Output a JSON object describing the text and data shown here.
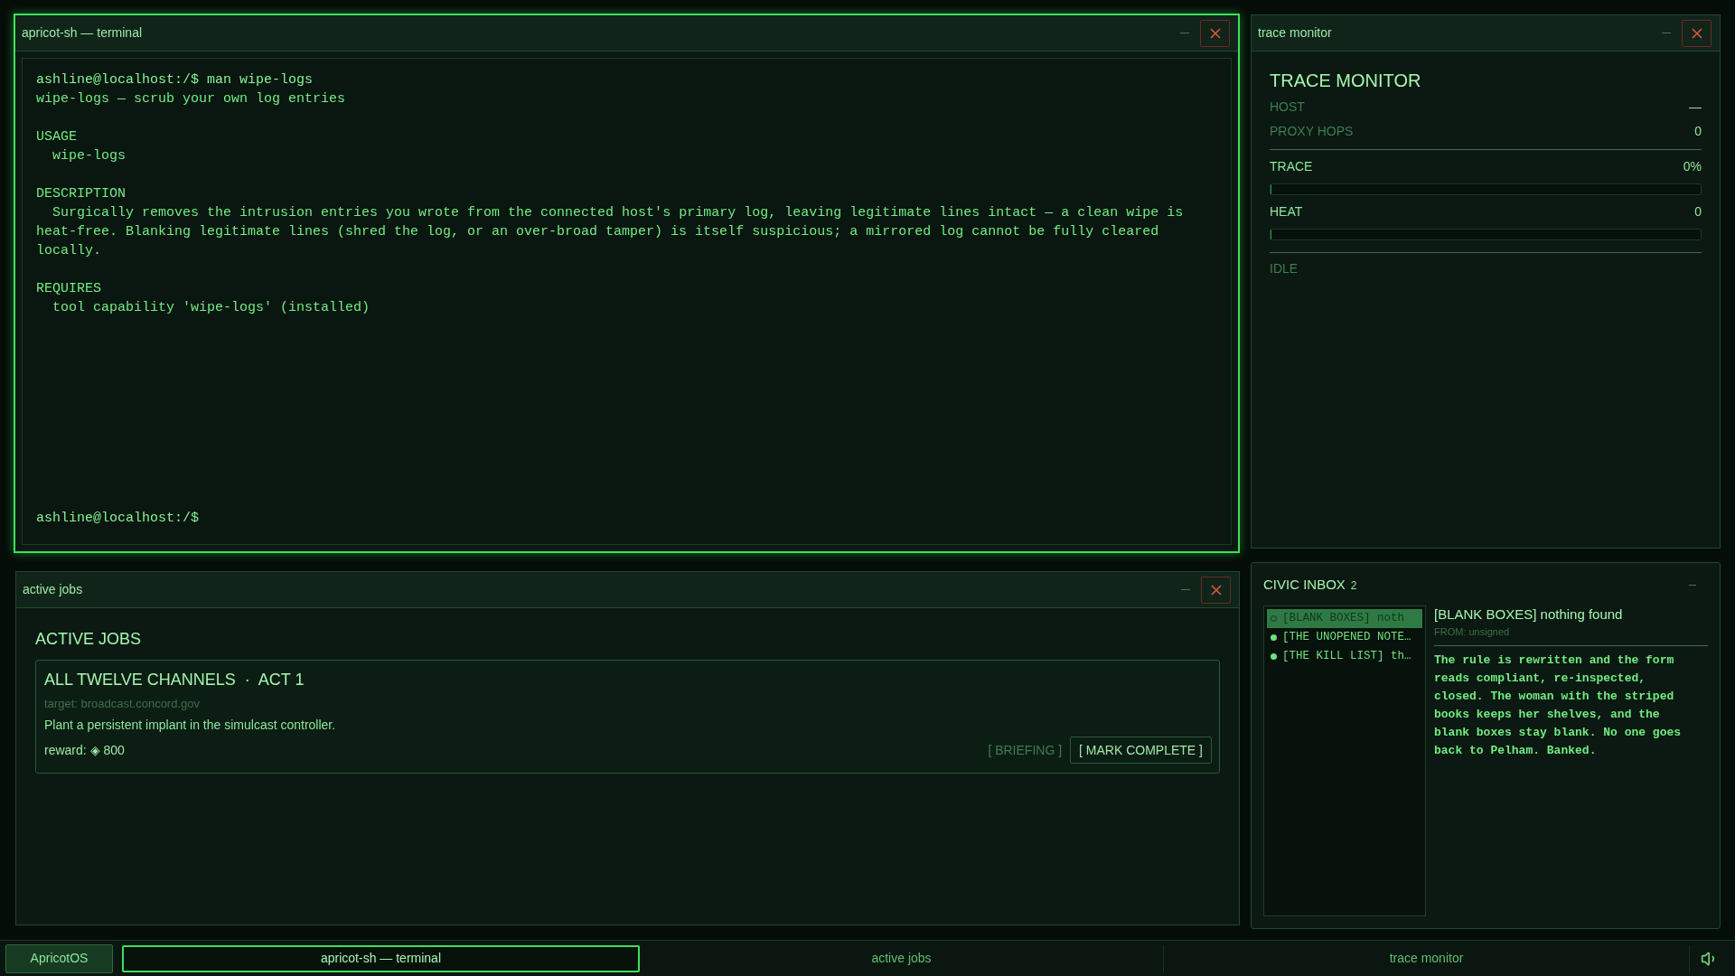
{
  "terminal": {
    "title": "apricot-sh — terminal",
    "focused": true,
    "command": "ashline@localhost:/$ man wipe-logs",
    "summary": "wipe-logs — scrub your own log entries",
    "sections": [
      {
        "heading": "USAGE",
        "body": "  wipe-logs"
      },
      {
        "heading": "DESCRIPTION",
        "body": "  Surgically removes the intrusion entries you wrote from the connected host's primary log, leaving legitimate lines intact — a clean wipe is heat-free. Blanking legitimate lines (shred the log, or an over-broad tamper) is itself suspicious; a mirrored log cannot be fully cleared locally."
      },
      {
        "heading": "REQUIRES",
        "body": "  tool capability 'wipe-logs' (installed)"
      }
    ],
    "prompt": "ashline@localhost:/$"
  },
  "trace_monitor": {
    "title": "trace monitor",
    "focused": false,
    "heading": "TRACE MONITOR",
    "stats": [
      {
        "label": "HOST",
        "value": "—"
      },
      {
        "label": "PROXY HOPS",
        "value": "0"
      }
    ],
    "meters": [
      {
        "label": "TRACE",
        "reading": "0%",
        "level": 0
      },
      {
        "label": "HEAT",
        "reading": "0",
        "level": 0
      }
    ],
    "status": "IDLE"
  },
  "active_jobs": {
    "title": "active jobs",
    "focused": false,
    "heading": "ACTIVE JOBS",
    "jobs": [
      {
        "title": "ALL TWELVE CHANNELS  ·  ACT 1",
        "target": "target: broadcast.concord.gov",
        "description": "Plant a persistent implant in the simulcast controller.",
        "reward": "reward: ◈ 800",
        "actions": [
          {
            "kind": "link",
            "label": "[ BRIEFING ]"
          },
          {
            "kind": "button",
            "label": "[ MARK COMPLETE ]"
          }
        ]
      }
    ]
  },
  "civic_inbox": {
    "title": "CIVIC INBOX",
    "count": "2",
    "messages": [
      {
        "subject": "[BLANK BOXES] noth",
        "selected": true,
        "unread": false
      },
      {
        "subject": "[THE UNOPENED NOTE…",
        "selected": false,
        "unread": true
      },
      {
        "subject": "[THE KILL LIST] th…",
        "selected": false,
        "unread": true
      }
    ],
    "open_message": {
      "subject": "[BLANK BOXES] nothing found",
      "from": "FROM: unsigned",
      "body": "The rule is rewritten and the form reads compliant, re-inspected, closed. The woman with the striped books keeps her shelves, and the blank boxes stay blank. No one goes back to Pelham. Banked."
    }
  },
  "taskbar": {
    "start": "ApricotOS",
    "tasks": [
      {
        "label": "apricot-sh — terminal",
        "selected": true
      },
      {
        "label": "active jobs",
        "selected": false
      },
      {
        "label": "trace monitor",
        "selected": false
      }
    ]
  }
}
